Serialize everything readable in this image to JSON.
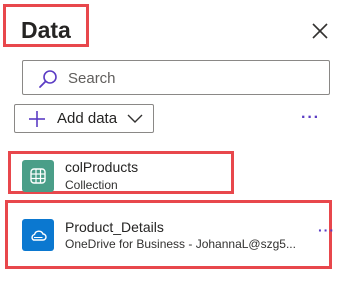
{
  "panel": {
    "title": "Data",
    "close_icon": "close-icon"
  },
  "search": {
    "placeholder": "Search",
    "icon": "search-icon"
  },
  "toolbar": {
    "add_data_label": "Add data",
    "more_label": "···"
  },
  "items": [
    {
      "title": "colProducts",
      "subtitle": "Collection",
      "icon": "table-icon",
      "icon_color": "#4a9e88"
    },
    {
      "title": "Product_Details",
      "subtitle": "OneDrive for Business - JohannaL@szg5...",
      "icon": "cloud-icon",
      "icon_color": "#0b78d0",
      "more_label": "···"
    }
  ],
  "colors": {
    "highlight": "#e8474c",
    "accent": "#5b3cc4"
  }
}
